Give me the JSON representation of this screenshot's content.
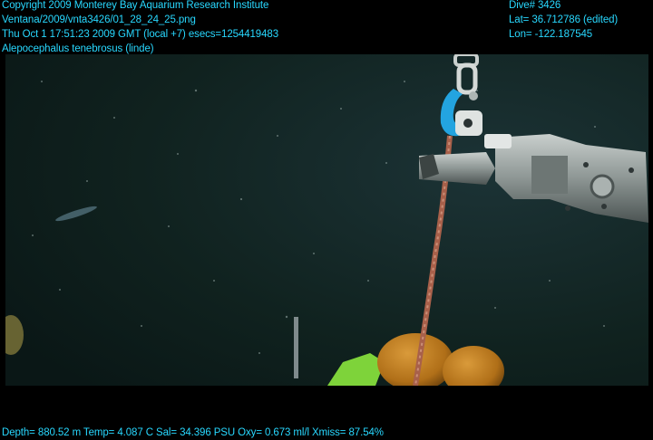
{
  "overlay": {
    "copyright": "Copyright 2009 Monterey Bay Aquarium Research Institute",
    "file_path": "Ventana/2009/vnta3426/01_28_24_25.png",
    "timestamp": "Thu Oct  1 17:51:23 2009 GMT (local +7)  esecs=1254419483",
    "species": "Alepocephalus tenebrosus (linde)",
    "dive": "Dive# 3426",
    "lat": "Lat= 36.712786 (edited)",
    "lon": "Lon= -122.187545",
    "telemetry": "Depth= 880.52 m  Temp= 4.087 C  Sal= 34.396 PSU  Oxy= 0.673 ml/l  Xmiss= 87.54%"
  },
  "colors": {
    "overlay_text": "#28d8ff",
    "background": "#000000",
    "water": "#13282b",
    "floats": "#b9781f",
    "green_gear": "#7ed33a"
  },
  "scene": {
    "objects": [
      "rov-manipulator-arm",
      "shackle",
      "blue-hook",
      "rope",
      "orange-floats",
      "green-gear",
      "fish-silhouette",
      "instrument-rod"
    ]
  }
}
